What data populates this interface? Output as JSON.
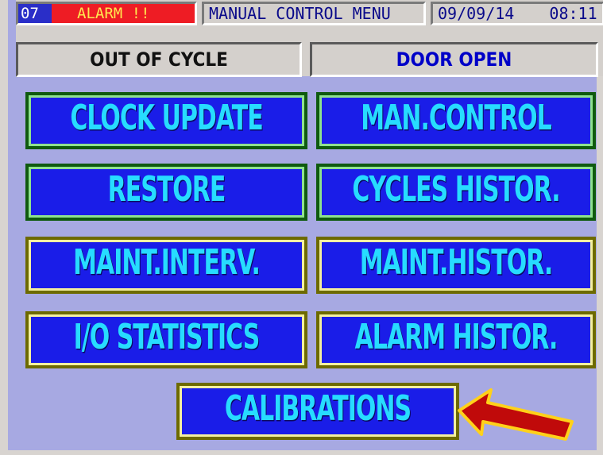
{
  "header": {
    "alarm_code": "07",
    "alarm_text": "ALARM !!",
    "menu_title": "MANUAL CONTROL MENU",
    "date": "09/09/14",
    "time": "08:11"
  },
  "status": {
    "cycle": "OUT OF CYCLE",
    "door": "DOOR OPEN"
  },
  "menu": {
    "clock_update": "CLOCK UPDATE",
    "man_control": "MAN.CONTROL",
    "restore": "RESTORE",
    "cycles_histor": "CYCLES HISTOR.",
    "maint_interv": "MAINT.INTERV.",
    "maint_histor": "MAINT.HISTOR.",
    "io_statistics": "I/O STATISTICS",
    "alarm_histor": "ALARM HISTOR.",
    "calibrations": "CALIBRATIONS"
  },
  "colors": {
    "screen_bg": "#a7a9e2",
    "button_fill": "#1a1de8",
    "button_text": "#27dcff",
    "alarm_red": "#ee1c24",
    "door_open_text": "#0000c8",
    "arrow_fill": "#c00a0a",
    "arrow_outline": "#ffd11a"
  },
  "annotations": {
    "arrow_icon": "red-arrow-pointing-left"
  }
}
